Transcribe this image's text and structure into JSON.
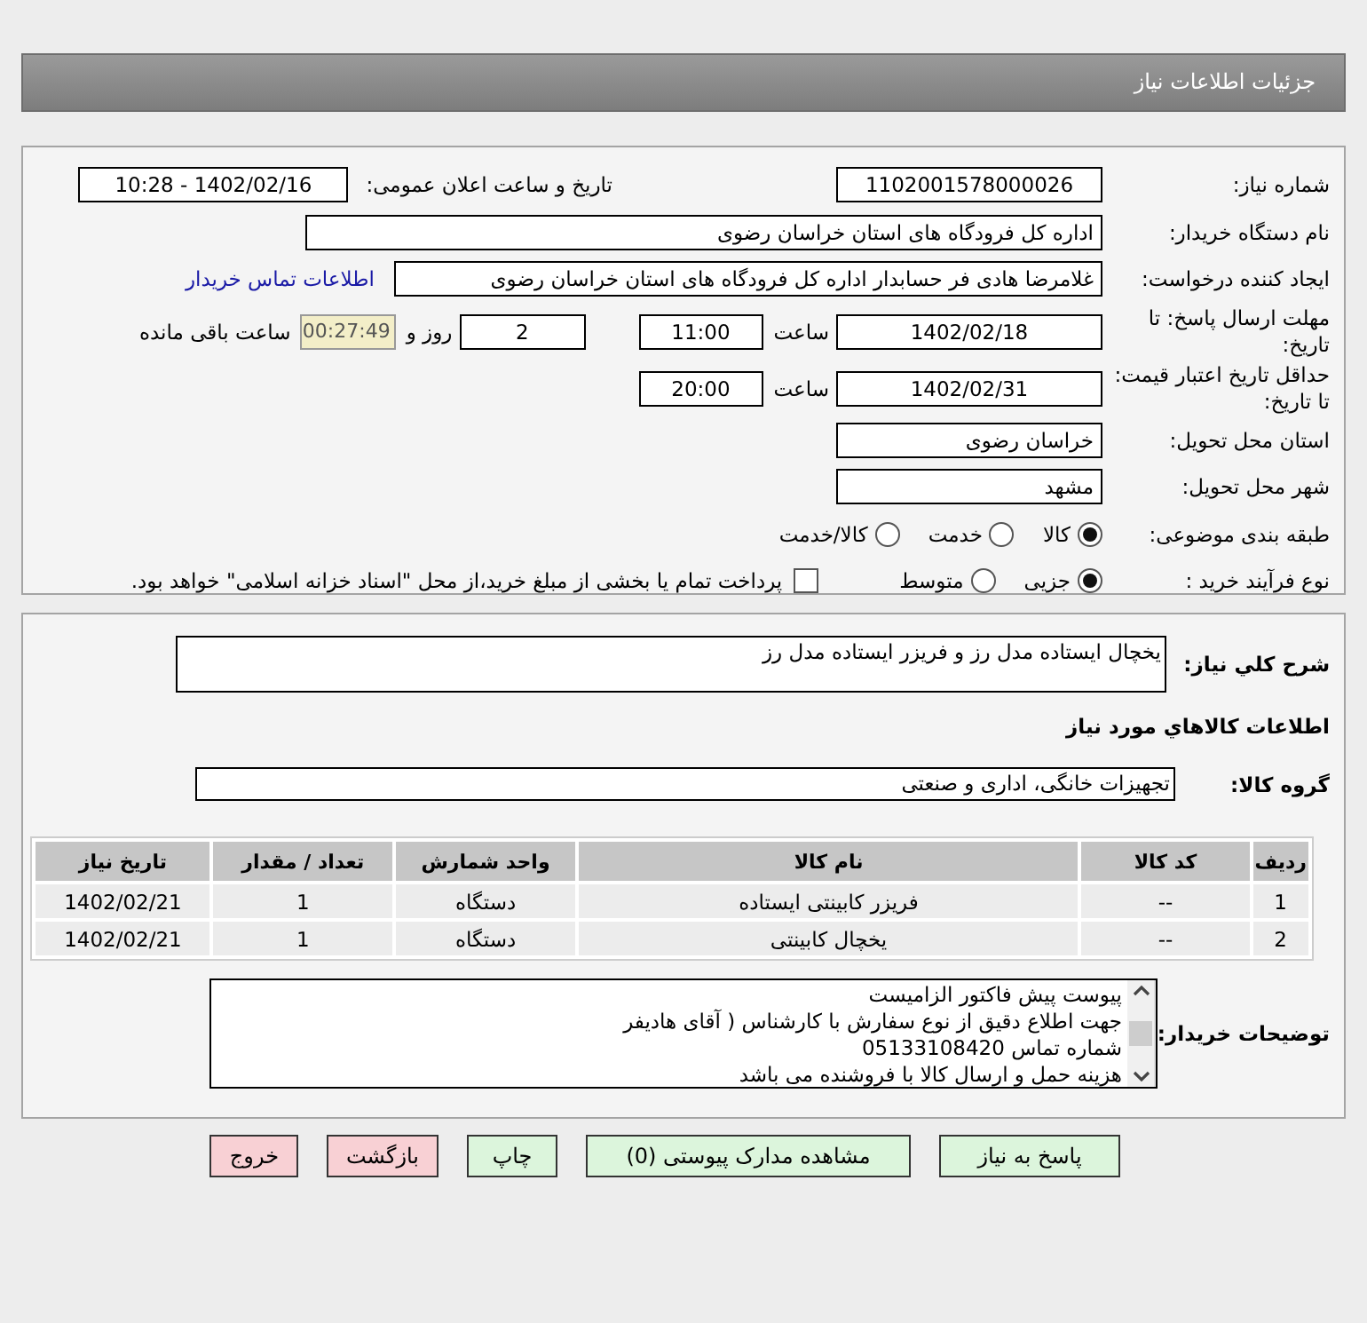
{
  "header": {
    "title": "جزئیات اطلاعات نیاز"
  },
  "need_info": {
    "need_number": {
      "label": "شماره نیاز:",
      "value": "1102001578000026"
    },
    "announce": {
      "label": "تاریخ و ساعت اعلان عمومی:",
      "value": "1402/02/16 - 10:28"
    },
    "buyer": {
      "label": "نام دستگاه خریدار:",
      "value": "اداره کل فرودگاه های استان خراسان رضوی"
    },
    "requester": {
      "label": "ایجاد کننده درخواست:",
      "value": "غلامرضا هادی فر حسابدار اداره کل فرودگاه های استان خراسان رضوی",
      "link": "اطلاعات تماس خریدار"
    },
    "deadline": {
      "label": "مهلت ارسال پاسخ: تا تاریخ:",
      "date": "1402/02/18",
      "time_label": "ساعت",
      "time": "11:00",
      "days": "2",
      "days_label": "روز و",
      "remaining": "00:27:49",
      "remaining_label": "ساعت باقی مانده"
    },
    "validity": {
      "label": "حداقل تاریخ اعتبار قیمت: تا تاریخ:",
      "date": "1402/02/31",
      "time_label": "ساعت",
      "time": "20:00"
    },
    "province": {
      "label": "استان محل تحویل:",
      "value": "خراسان رضوی"
    },
    "city": {
      "label": "شهر محل تحویل:",
      "value": "مشهد"
    },
    "category": {
      "label": "طبقه بندی موضوعی:",
      "options": [
        {
          "label": "کالا",
          "selected": true
        },
        {
          "label": "خدمت",
          "selected": false
        },
        {
          "label": "کالا/خدمت",
          "selected": false
        }
      ]
    },
    "process": {
      "label": "نوع فرآیند خرید :",
      "options": [
        {
          "label": "جزیی",
          "selected": true
        },
        {
          "label": "متوسط",
          "selected": false
        }
      ],
      "payment": {
        "checked": false,
        "text": "پرداخت تمام یا بخشی از مبلغ خرید،از محل \"اسناد خزانه اسلامی\" خواهد بود."
      }
    }
  },
  "goods": {
    "description": {
      "label": "شرح کلي نياز:",
      "value": "يخچال ايستاده مدل رز و فريزر ايستاده مدل رز"
    },
    "section_title": "اطلاعات كالاهاي مورد نياز",
    "group": {
      "label": "گروه کالا:",
      "value": "تجهیزات خانگی، اداری و صنعتی"
    },
    "table": {
      "columns": [
        "ردیف",
        "کد کالا",
        "نام کالا",
        "واحد شمارش",
        "تعداد / مقدار",
        "تاریخ نیاز"
      ],
      "rows": [
        [
          "1",
          "--",
          "فریزر کابینتی ایستاده",
          "دستگاه",
          "1",
          "1402/02/21"
        ],
        [
          "2",
          "--",
          "یخچال کابینتی",
          "دستگاه",
          "1",
          "1402/02/21"
        ]
      ]
    },
    "notes": {
      "label": "توضیحات خریدار:",
      "lines": [
        "پیوست پیش فاکتور الزامیست",
        "جهت اطلاع دقیق از نوع سفارش با کارشناس  ( آقای هادیفر",
        "شماره تماس  05133108420",
        "هزینه حمل و ارسال کالا با فروشنده می باشد"
      ]
    }
  },
  "buttons": [
    {
      "label": "پاسخ به نیاز",
      "kind": "action"
    },
    {
      "label": "مشاهده مدارک پیوستی (0)",
      "kind": "action"
    },
    {
      "label": "چاپ",
      "kind": "action"
    },
    {
      "label": "بازگشت",
      "kind": "exit"
    },
    {
      "label": "خروج",
      "kind": "exit"
    }
  ]
}
